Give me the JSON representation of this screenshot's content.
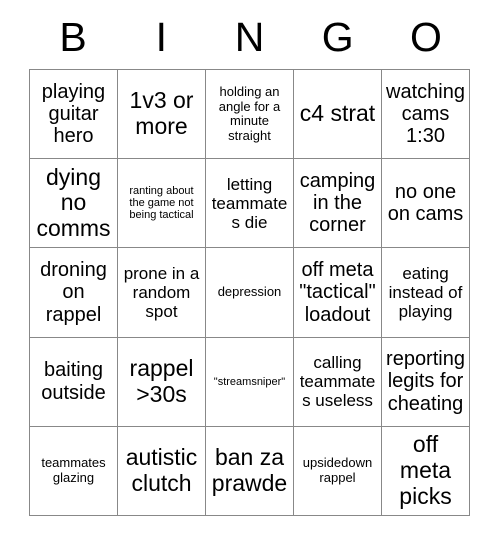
{
  "card": {
    "header_letters": [
      "B",
      "I",
      "N",
      "G",
      "O"
    ],
    "rows": [
      [
        {
          "text": "playing guitar hero",
          "size": "lg"
        },
        {
          "text": "1v3 or more",
          "size": "xl"
        },
        {
          "text": "holding an angle for a minute straight",
          "size": "sm"
        },
        {
          "text": "c4 strat",
          "size": "xl"
        },
        {
          "text": "watching cams 1:30",
          "size": "lg"
        }
      ],
      [
        {
          "text": "dying no comms",
          "size": "xl"
        },
        {
          "text": "ranting about the game not being tactical",
          "size": "xs"
        },
        {
          "text": "letting teammates die",
          "size": "md"
        },
        {
          "text": "camping in the corner",
          "size": "lg"
        },
        {
          "text": "no one on cams",
          "size": "lg"
        }
      ],
      [
        {
          "text": "droning on rappel",
          "size": "lg"
        },
        {
          "text": "prone in a random spot",
          "size": "md"
        },
        {
          "text": "depression",
          "size": "sm"
        },
        {
          "text": "off meta \"tactical\" loadout",
          "size": "lg"
        },
        {
          "text": "eating instead of playing",
          "size": "md"
        }
      ],
      [
        {
          "text": "baiting outside",
          "size": "lg"
        },
        {
          "text": "rappel >30s",
          "size": "xl"
        },
        {
          "text": "\"streamsniper\"",
          "size": "xs"
        },
        {
          "text": "calling teammates useless",
          "size": "md"
        },
        {
          "text": "reporting legits for cheating",
          "size": "lg"
        }
      ],
      [
        {
          "text": "teammates glazing",
          "size": "sm"
        },
        {
          "text": "autistic clutch",
          "size": "xl"
        },
        {
          "text": "ban za prawde",
          "size": "xl"
        },
        {
          "text": "upsidedown rappel",
          "size": "sm"
        },
        {
          "text": "off meta picks",
          "size": "xl"
        }
      ]
    ]
  },
  "colors": {
    "background": "#ffffff",
    "text": "#000000",
    "grid_line": "#888888"
  }
}
